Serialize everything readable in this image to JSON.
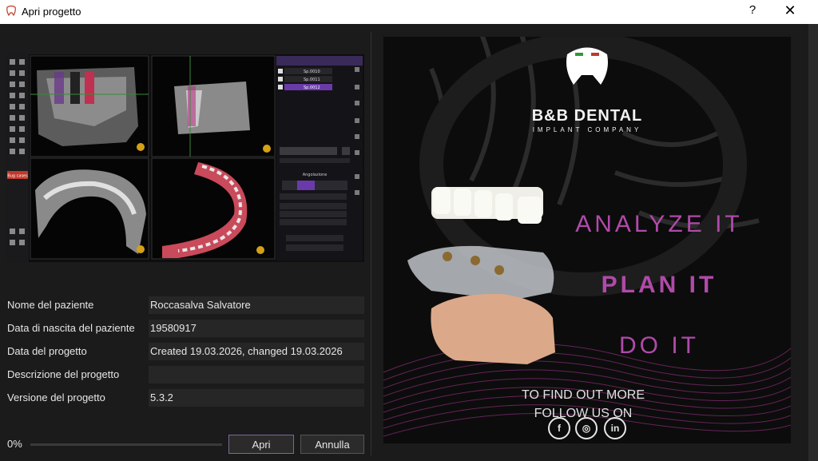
{
  "window": {
    "title": "Apri progetto",
    "help_label": "?",
    "close_label": "✕"
  },
  "preview": {
    "icon": "dental-software-screenshot",
    "sidebar_button": "Bug cases",
    "list_items": [
      "Sp.0010",
      "Sp.0011",
      "Sp.0012"
    ],
    "section_label": "Angolazione"
  },
  "fields": [
    {
      "label": "Nome del paziente",
      "value": "Roccasalva Salvatore"
    },
    {
      "label": "Data di nascita del paziente",
      "value": "19580917"
    },
    {
      "label": "Data del progetto",
      "value": "Created 19.03.2026, changed 19.03.2026"
    },
    {
      "label": "Descrizione del progetto",
      "value": ""
    },
    {
      "label": "Versione del progetto",
      "value": "5.3.2"
    }
  ],
  "progress": {
    "label": "0%",
    "value": 0
  },
  "buttons": {
    "open": "Apri",
    "cancel": "Annulla"
  },
  "ad": {
    "brand": "B&B DENTAL",
    "tagline": "IMPLANT COMPANY",
    "line1": "ANALYZE IT",
    "line2": "PLAN IT",
    "line3": "DO IT",
    "cta1": "TO FIND OUT MORE",
    "cta2": "FOLLOW US ON",
    "social": [
      {
        "icon": "facebook-icon",
        "glyph": "f"
      },
      {
        "icon": "instagram-icon",
        "glyph": "◎"
      },
      {
        "icon": "linkedin-icon",
        "glyph": "in"
      }
    ],
    "accent": "#b04aa9"
  }
}
